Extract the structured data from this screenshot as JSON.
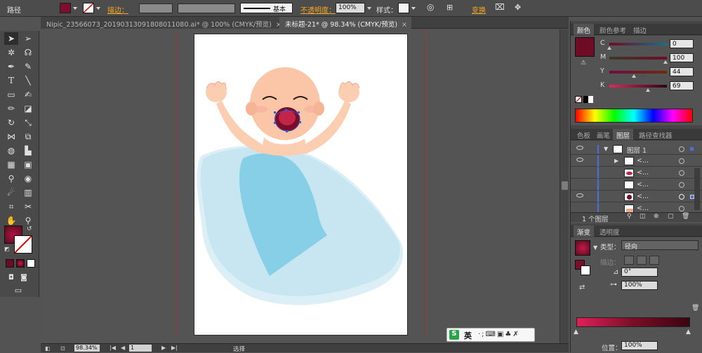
{
  "control_bar": {
    "object_type": "路径",
    "fill_color": "#7c0f2d",
    "stroke_label": "描边：",
    "stroke_profile": "基本",
    "opacity_label": "不透明度：",
    "opacity_value": "100%",
    "style_label": "样式：",
    "transform_label": "变换"
  },
  "doc_tabs": [
    {
      "label": "Nipic_23566073_20190313091808011080.ai* @ 100% (CMYK/预览)",
      "close": "×"
    },
    {
      "label": "未标题-21* @ 98.34% (CMYK/预览)",
      "close": "×"
    }
  ],
  "status_bar": {
    "zoom": "98.34%",
    "page": "1",
    "tool_name": "选择"
  },
  "color_panel": {
    "tabs": [
      "颜色",
      "颜色参考",
      "描边"
    ],
    "swatch": "#6e0c25",
    "channels": [
      {
        "name": "C",
        "value": "0",
        "level": 0.0,
        "color": "#00a8c8"
      },
      {
        "name": "M",
        "value": "100",
        "level": 1.0,
        "color": "#d4156b"
      },
      {
        "name": "Y",
        "value": "44",
        "level": 0.44,
        "color": "#c8b82a"
      },
      {
        "name": "K",
        "value": "69",
        "level": 0.69,
        "color": "#2a2a2a"
      }
    ]
  },
  "layers_panel": {
    "tabs": [
      "色板",
      "画笔",
      "图层",
      "路径查找器"
    ],
    "layer_name": "图层 1",
    "sublayer_label": "<...",
    "rows": [
      {
        "indent": "layer",
        "name": "图层 1"
      },
      {
        "indent": "item",
        "name": "<..."
      },
      {
        "indent": "item",
        "name": "<..."
      },
      {
        "indent": "item",
        "name": "<..."
      },
      {
        "indent": "item",
        "name": "<..."
      },
      {
        "indent": "item",
        "name": "<..."
      }
    ],
    "footer": "1 个图层"
  },
  "gradient_panel": {
    "tabs": [
      "渐变",
      "透明度"
    ],
    "type_label": "类型：",
    "type_value": "径向",
    "stroke_label": "描边：",
    "angle_value": "0°",
    "aspect_value": "100%",
    "position_label": "位置：",
    "position_value": "100%",
    "swatch": "#7a0f2a"
  },
  "ime": {
    "brand": "S",
    "lang": "英",
    "icons": "·;⌨▣♣✗"
  }
}
